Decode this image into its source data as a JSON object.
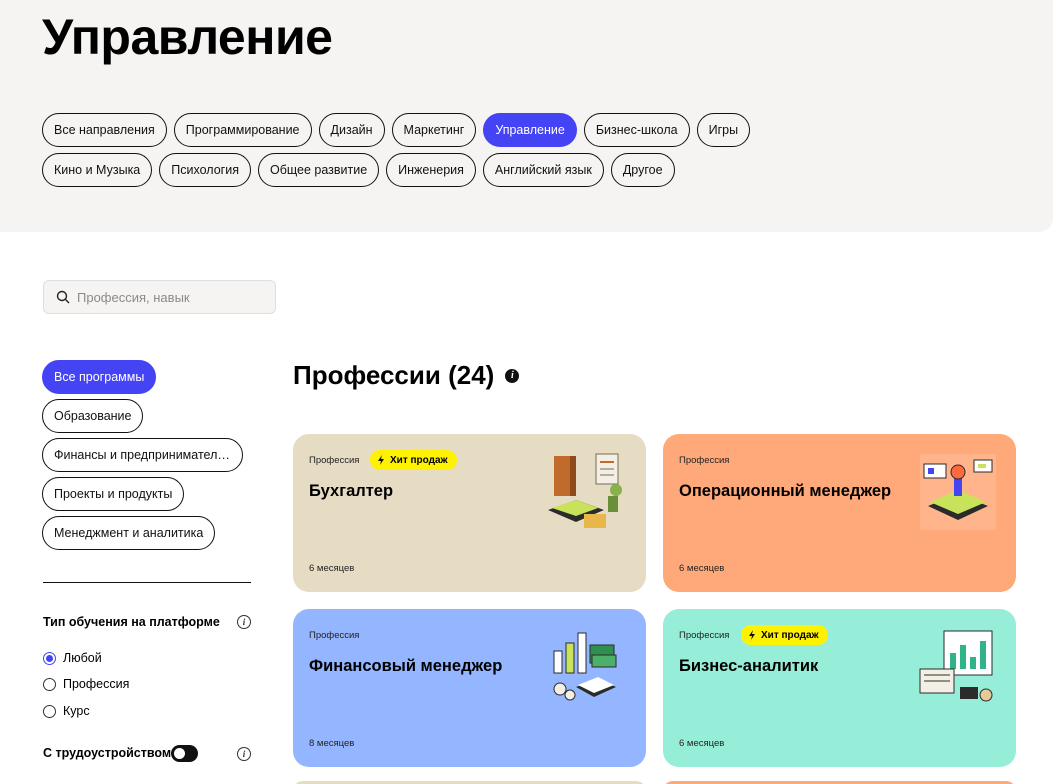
{
  "page": {
    "title": "Управление"
  },
  "categories": {
    "row1": [
      "Все направления",
      "Программирование",
      "Дизайн",
      "Маркетинг",
      "Управление",
      "Бизнес-школа",
      "Игры"
    ],
    "row2": [
      "Кино и Музыка",
      "Психология",
      "Общее развитие",
      "Инженерия",
      "Английский язык",
      "Другое"
    ],
    "active": "Управление"
  },
  "search": {
    "placeholder": "Профессия, навык",
    "value": ""
  },
  "programs": {
    "items": [
      "Все программы",
      "Образование",
      "Финансы и предпринимательство",
      "Проекты и продукты",
      "Менеджмент и аналитика"
    ],
    "active": "Все программы"
  },
  "filters": {
    "type_label": "Тип обучения на платформе",
    "options": [
      "Любой",
      "Профессия",
      "Курс"
    ],
    "selected": "Любой",
    "employment_label": "С трудоустройством",
    "employment_on": true
  },
  "section": {
    "title": "Профессии (24)"
  },
  "cards": [
    {
      "kind": "Профессия",
      "badge": "Хит продаж",
      "name": "Бухгалтер",
      "duration": "6 месяцев",
      "color": "#e6dcc4",
      "icon": "accounting-illustration-icon"
    },
    {
      "kind": "Профессия",
      "badge": "",
      "name": "Операционный менеджер",
      "duration": "6 месяцев",
      "color": "#ffa97a",
      "icon": "operations-illustration-icon"
    },
    {
      "kind": "Профессия",
      "badge": "",
      "name": "Финансовый менеджер",
      "duration": "8 месяцев",
      "color": "#94b5ff",
      "icon": "finance-illustration-icon"
    },
    {
      "kind": "Профессия",
      "badge": "Хит продаж",
      "name": "Бизнес-аналитик",
      "duration": "6 месяцев",
      "color": "#97eed8",
      "icon": "analytics-illustration-icon"
    }
  ],
  "colors": {
    "accent": "#4544f5",
    "badge": "#fff200",
    "band": "#f5f4f2"
  }
}
